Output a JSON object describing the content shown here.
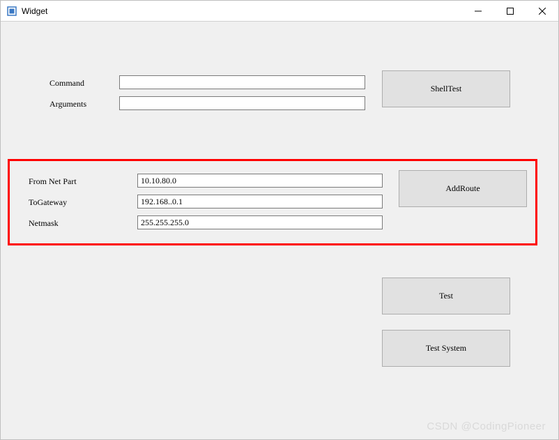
{
  "window": {
    "title": "Widget"
  },
  "section1": {
    "command_label": "Command",
    "command_value": "",
    "arguments_label": "Arguments",
    "arguments_value": "",
    "shelltest_label": "ShellTest"
  },
  "section2": {
    "fromnet_label": "From Net Part",
    "fromnet_value": "10.10.80.0",
    "togateway_label": "ToGateway",
    "togateway_value": "192.168..0.1",
    "netmask_label": "Netmask",
    "netmask_value": "255.255.255.0",
    "addroute_label": "AddRoute"
  },
  "buttons": {
    "test_label": "Test",
    "testsystem_label": "Test System"
  },
  "watermark": "CSDN @CodingPioneer"
}
